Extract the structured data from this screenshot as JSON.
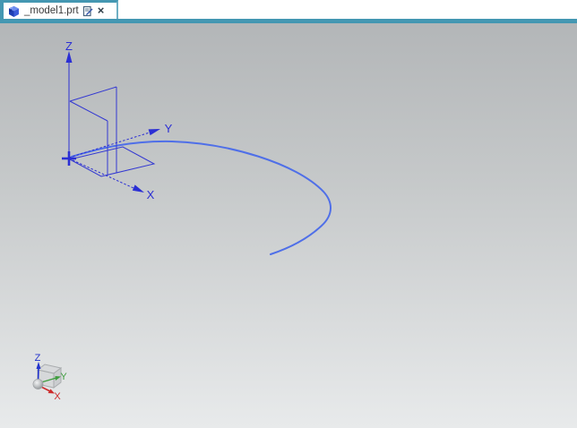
{
  "window": {
    "title": "_model1.prt"
  },
  "tab_bar": {
    "tabs": [
      {
        "label": "_model1.prt",
        "active": true,
        "close_glyph": "×"
      }
    ]
  },
  "viewport": {
    "csys_labels": {
      "x": "X",
      "y": "Y",
      "z": "Z"
    },
    "triad_labels": {
      "x": "X",
      "y": "Y",
      "z": "Z"
    },
    "colors": {
      "accent_teal": "#4497b2",
      "geometry_blue": "#2b2fd4",
      "curve_blue": "#4f6fe8",
      "triad_x_red": "#cc2a2a",
      "triad_y_green": "#3f9d3f",
      "triad_z_blue": "#2233cc",
      "background_top": "#b3b6b8",
      "background_bottom": "#e8eaeb"
    },
    "icons": [
      "part-icon",
      "modified-indicator-icon",
      "close-icon",
      "origin-cross",
      "axis-arrowhead",
      "view-triad-cube",
      "view-triad-sphere"
    ]
  }
}
